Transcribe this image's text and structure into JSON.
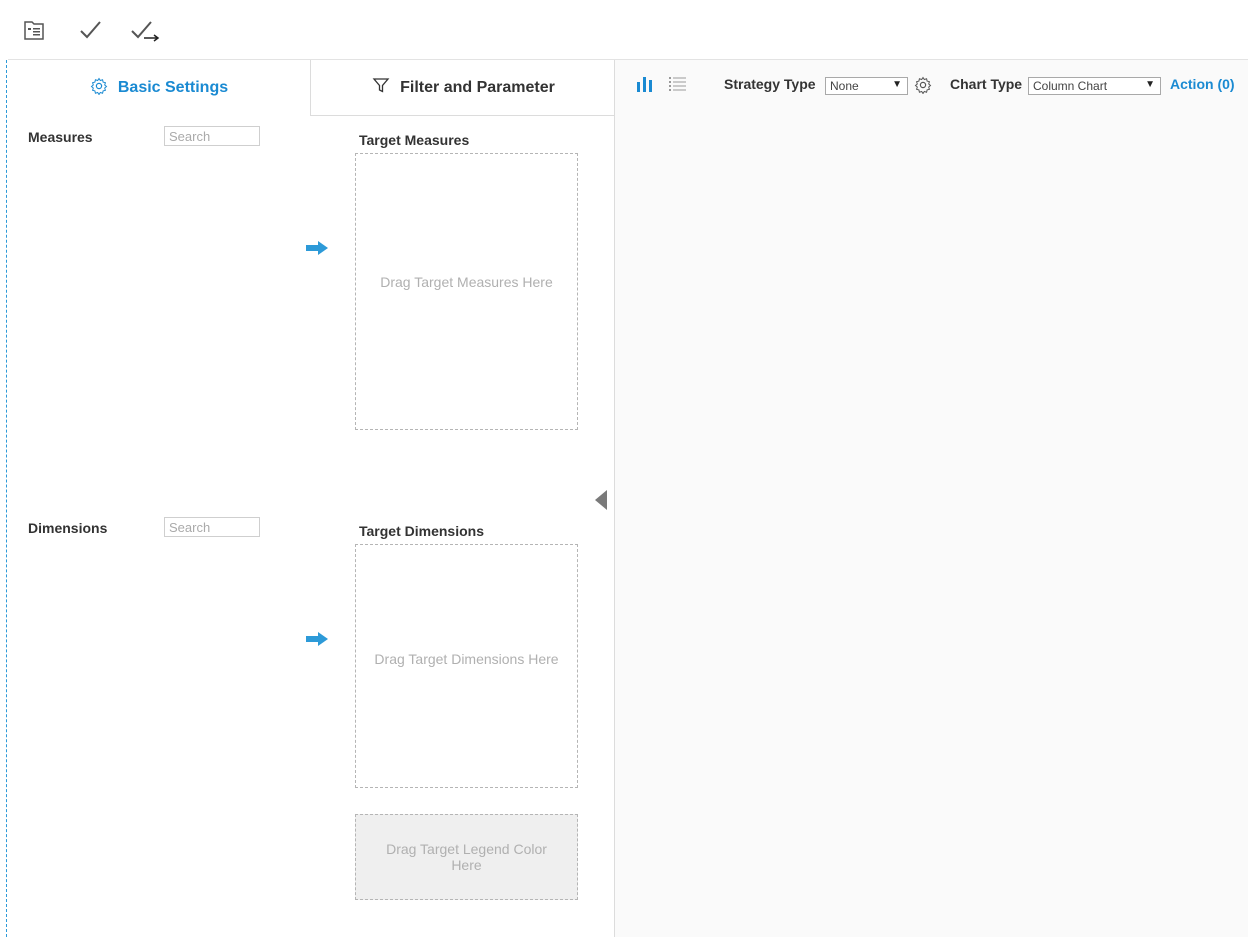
{
  "toolbar": {
    "icons": [
      "properties-icon",
      "check-icon",
      "check-next-icon"
    ]
  },
  "tabs": {
    "basic_settings": "Basic Settings",
    "filter_parameter": "Filter and Parameter"
  },
  "measures": {
    "label": "Measures",
    "search_placeholder": "Search",
    "target_title": "Target Measures",
    "drop_text": "Drag Target Measures Here"
  },
  "dimensions": {
    "label": "Dimensions",
    "search_placeholder": "Search",
    "target_title": "Target Dimensions",
    "drop_text": "Drag Target Dimensions Here"
  },
  "legend": {
    "drop_text": "Drag Target Legend Color Here"
  },
  "chart_toolbar": {
    "strategy_label": "Strategy Type",
    "strategy_value": "None",
    "chart_type_label": "Chart Type",
    "chart_type_value": "Column Chart",
    "action_label": "Action (0)"
  },
  "colors": {
    "accent": "#1a8ad2",
    "arrow": "#2d9ad8",
    "guide": "#2d9ad8"
  }
}
